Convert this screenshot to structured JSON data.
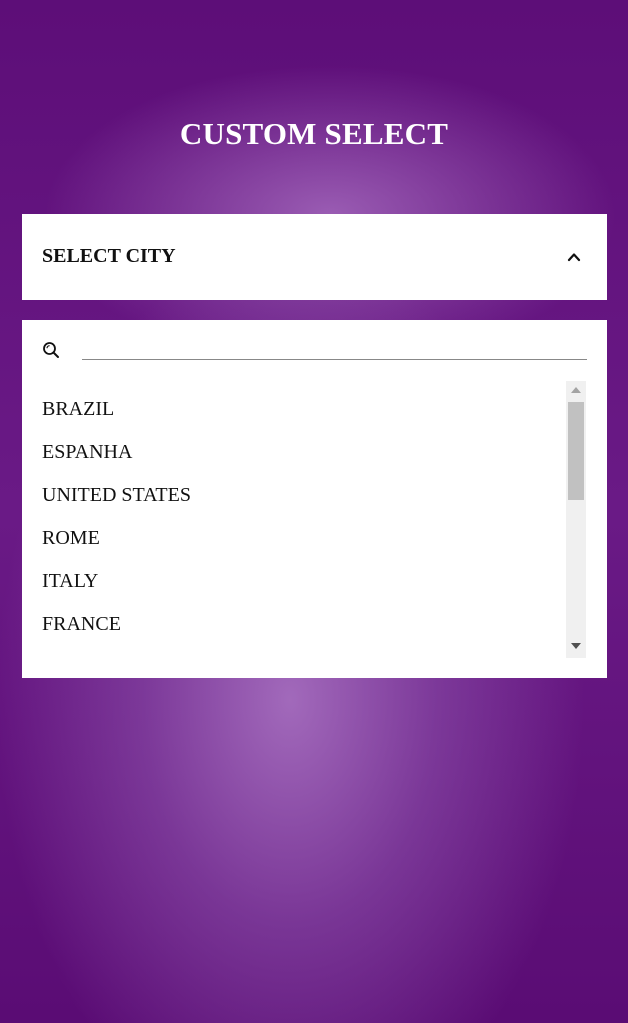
{
  "page": {
    "title": "CUSTOM SELECT"
  },
  "select": {
    "label": "SELECT CITY",
    "state": "open",
    "toggle_icon": "chevron-up-icon"
  },
  "search": {
    "icon": "search-icon",
    "value": "",
    "placeholder": ""
  },
  "options": [
    {
      "label": "BRAZIL"
    },
    {
      "label": "ESPANHA"
    },
    {
      "label": "UNITED STATES"
    },
    {
      "label": "ROME"
    },
    {
      "label": "ITALY"
    },
    {
      "label": "FRANCE"
    }
  ],
  "colors": {
    "background_dark": "#5d0e78",
    "background_light": "#a56ebe",
    "panel": "#ffffff",
    "text": "#111111",
    "title": "#ffffff"
  }
}
